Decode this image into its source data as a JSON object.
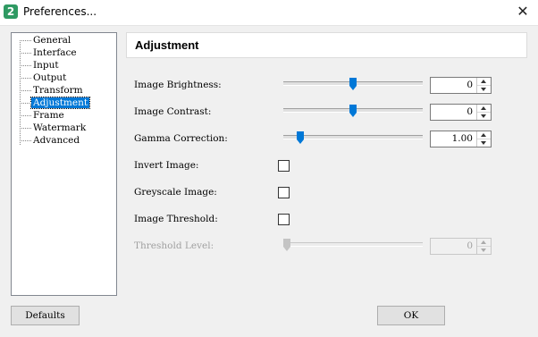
{
  "window": {
    "title": "Preferences...",
    "app_icon_glyph": "2"
  },
  "tree": {
    "items": [
      {
        "label": "General",
        "selected": false
      },
      {
        "label": "Interface",
        "selected": false
      },
      {
        "label": "Input",
        "selected": false
      },
      {
        "label": "Output",
        "selected": false
      },
      {
        "label": "Transform",
        "selected": false
      },
      {
        "label": "Adjustment",
        "selected": true
      },
      {
        "label": "Frame",
        "selected": false
      },
      {
        "label": "Watermark",
        "selected": false
      },
      {
        "label": "Advanced",
        "selected": false
      }
    ]
  },
  "panel": {
    "title": "Adjustment",
    "brightness": {
      "label": "Image Brightness:",
      "value": "0",
      "slider_fraction": 0.5
    },
    "contrast": {
      "label": "Image Contrast:",
      "value": "0",
      "slider_fraction": 0.5
    },
    "gamma": {
      "label": "Gamma Correction:",
      "value": "1.00",
      "slider_fraction": 0.1
    },
    "invert": {
      "label": "Invert Image:",
      "checked": false
    },
    "greyscale": {
      "label": "Greyscale Image:",
      "checked": false
    },
    "threshold": {
      "label": "Image Threshold:",
      "checked": false
    },
    "threshold_level": {
      "label": "Threshold Level:",
      "value": "0",
      "slider_fraction": 0.0,
      "disabled": true
    }
  },
  "buttons": {
    "defaults": "Defaults",
    "ok": "OK"
  },
  "colors": {
    "selection": "#0078d7",
    "thumb": "#0078d7",
    "window_bg": "#f0f0f0"
  },
  "icons": {
    "close": "close-icon",
    "app": "app-icon",
    "thumb": "slider-thumb-icon"
  }
}
